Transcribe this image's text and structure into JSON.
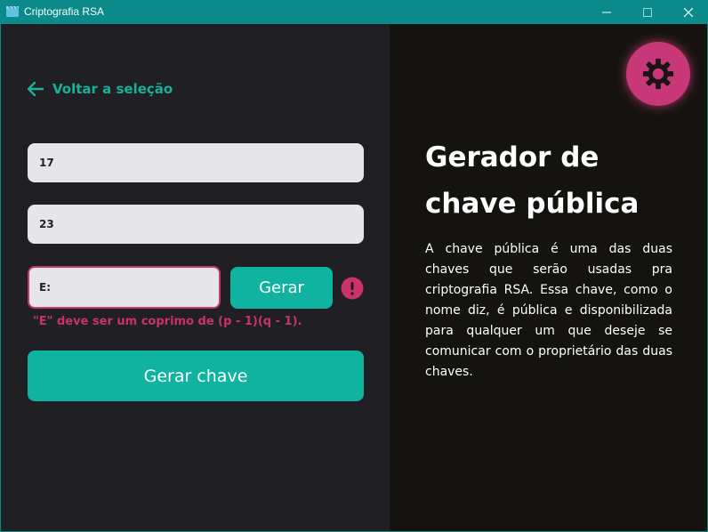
{
  "window": {
    "title": "Criptografia RSA",
    "icons": {
      "app": "clapperboard-icon",
      "minimize": "minimize-icon",
      "maximize": "maximize-icon",
      "close": "close-icon"
    }
  },
  "left": {
    "back_label": "Voltar a seleção",
    "back_icon": "arrow-left-icon",
    "p_value": "17",
    "q_value": "23",
    "e_placeholder": "E:",
    "gerar_label": "Gerar",
    "error_icon": "exclamation-circle-icon",
    "error_text": "\"E\" deve ser um coprimo de (p - 1)(q - 1).",
    "generate_key_label": "Gerar chave"
  },
  "right": {
    "settings_icon": "gear-icon",
    "heading_line1": "Gerador de",
    "heading_line2": "chave pública",
    "description": "A chave pública é uma das duas chaves que serão usadas pra criptografia RSA. Essa chave, como o nome diz, é pública e disponibilizada para qualquer um que deseje se comunicar com o proprietário das duas chaves."
  },
  "colors": {
    "accent": "#0fb39f",
    "error": "#c9336a",
    "titlebar": "#0a8a8a",
    "gear": "#c83777"
  }
}
